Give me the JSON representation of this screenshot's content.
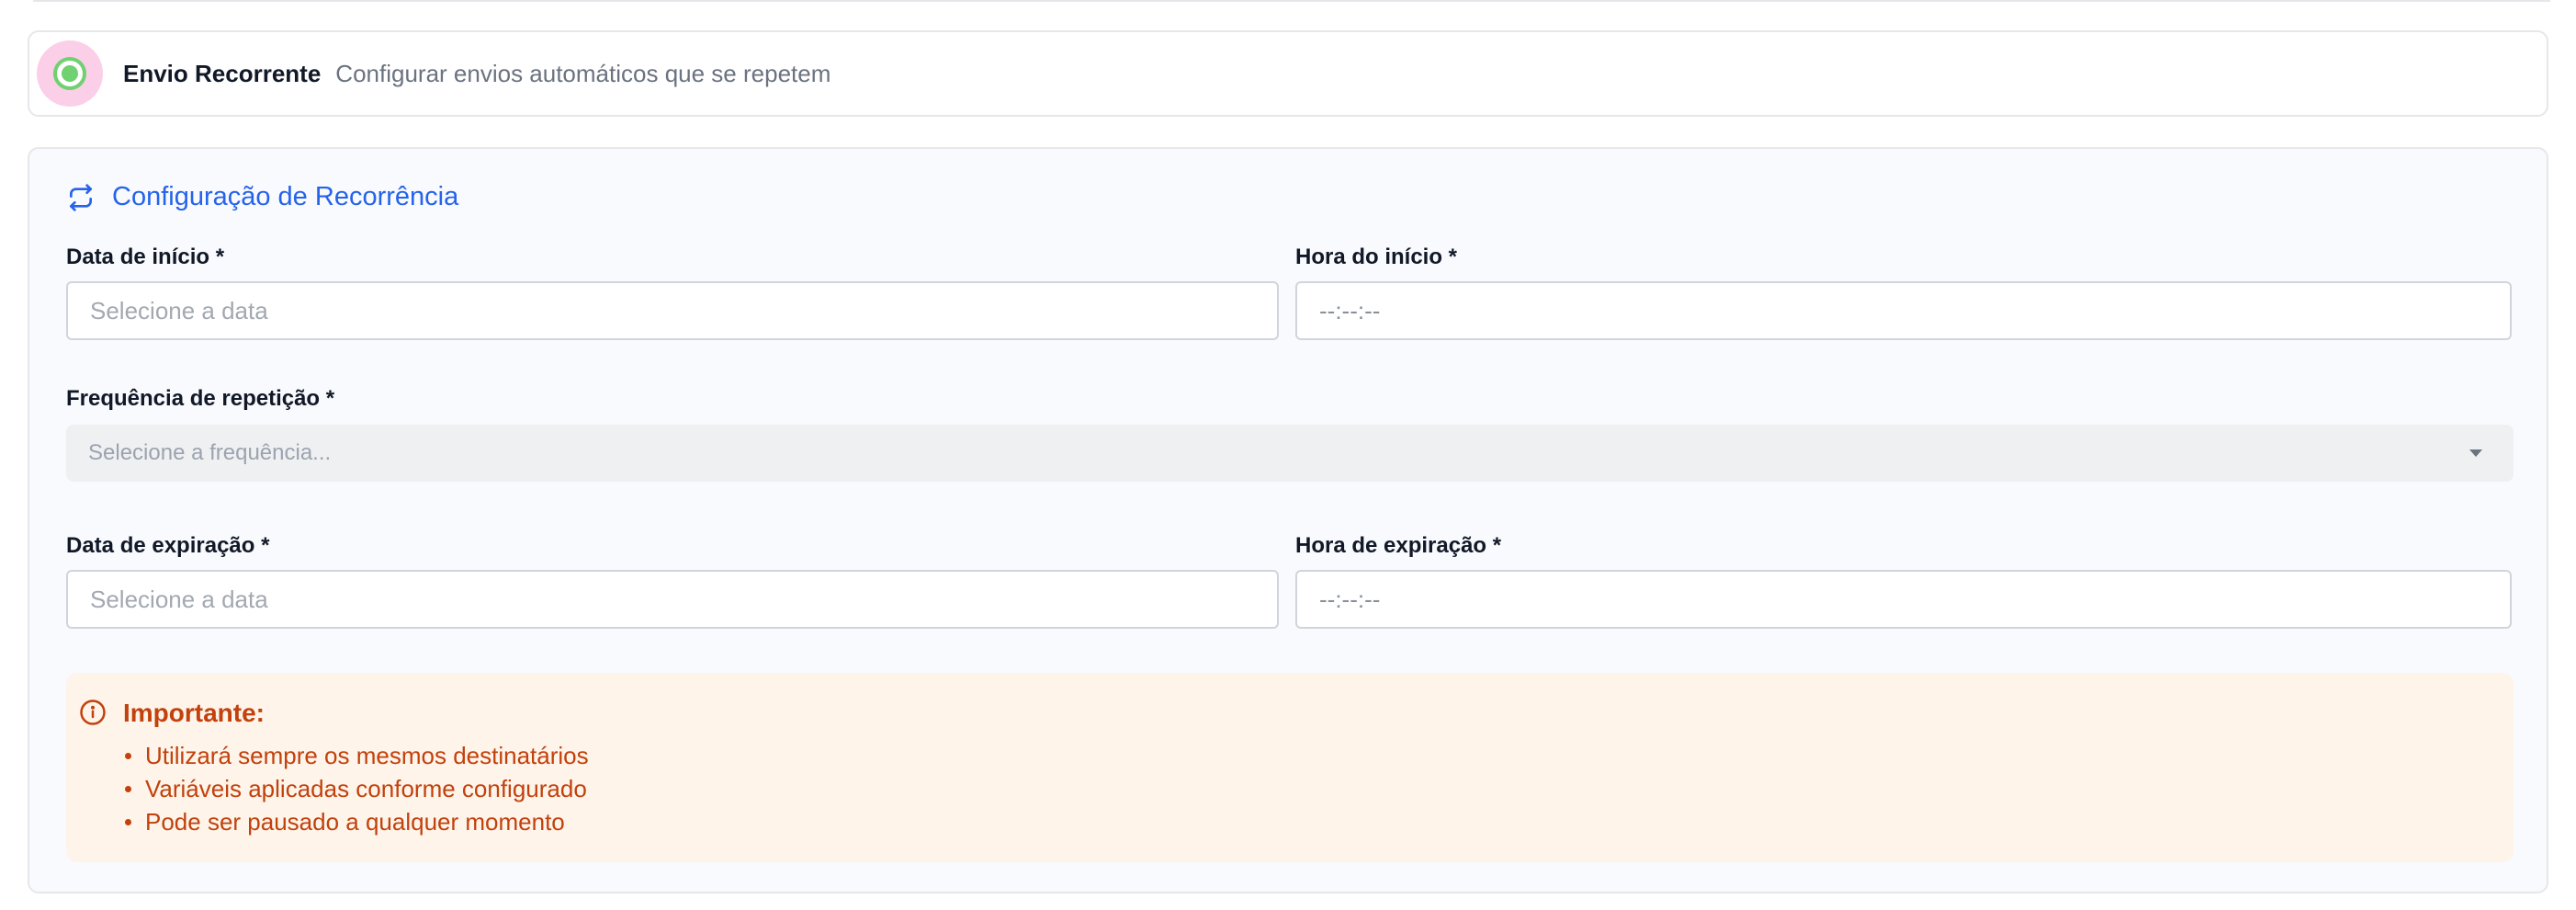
{
  "option": {
    "title": "Envio Recorrente",
    "description": "Configurar envios automáticos que se repetem",
    "selected": true
  },
  "panel": {
    "title": "Configuração de Recorrência",
    "icon": "repeat-icon",
    "start_date": {
      "label": "Data de início *",
      "placeholder": "Selecione a data",
      "value": ""
    },
    "start_time": {
      "label": "Hora do início *",
      "value": "--:--:--"
    },
    "frequency": {
      "label": "Frequência de repetição *",
      "placeholder": "Selecione a frequência..."
    },
    "expiry_date": {
      "label": "Data de expiração *",
      "placeholder": "Selecione a data",
      "value": ""
    },
    "expiry_time": {
      "label": "Hora de expiração *",
      "value": "--:--:--"
    }
  },
  "notice": {
    "icon": "info-icon",
    "title": "Importante:",
    "items": [
      "Utilizará sempre os mesmos destinatários",
      "Variáveis aplicadas conforme configurado",
      "Pode ser pausado a qualquer momento"
    ]
  },
  "colors": {
    "accent_blue": "#2563eb",
    "radio_green": "#6fd16f",
    "radio_halo": "#fbcfe8",
    "notice_text": "#c2410c",
    "notice_bg": "#fef4ea"
  }
}
